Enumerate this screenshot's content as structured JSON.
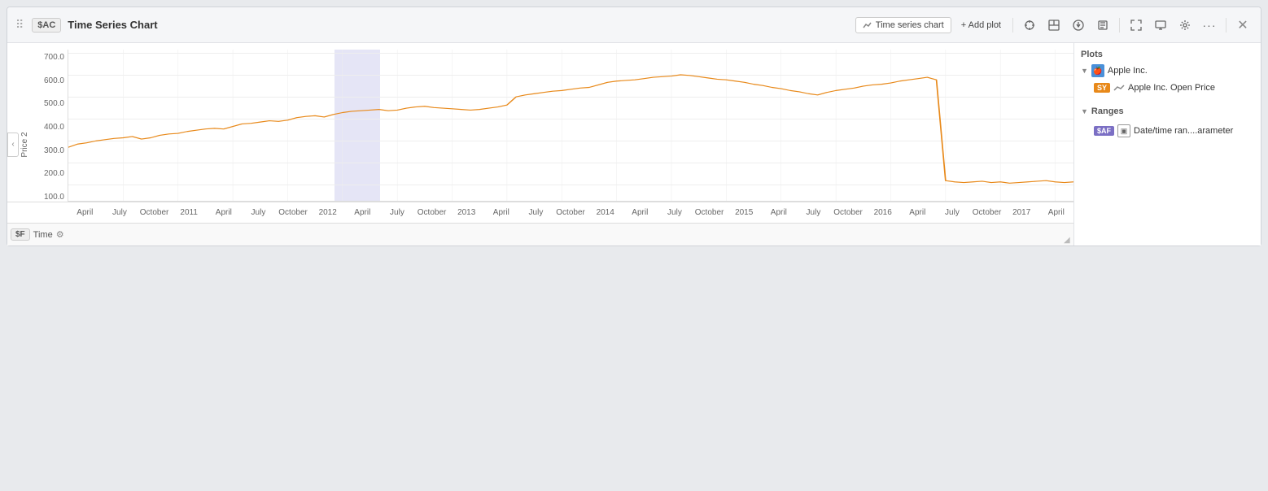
{
  "header": {
    "drag_handle": "⠿",
    "badge": "$AC",
    "title": "Time Series Chart",
    "time_series_btn": "Time series chart",
    "add_plot_btn": "+ Add plot",
    "close_btn": "✕"
  },
  "toolbar_icons": {
    "crosshair": "⊕",
    "layout": "▣",
    "download": "↓",
    "edit": "✎",
    "fullscreen": "⛶",
    "monitor": "🖥",
    "settings": "⚙",
    "more": "•••"
  },
  "chart": {
    "y_axis_label": "Price 2",
    "y_ticks": [
      "700.0",
      "600.0",
      "500.0",
      "400.0",
      "300.0",
      "200.0",
      "100.0"
    ],
    "x_ticks": [
      "April",
      "July",
      "October",
      "2011",
      "April",
      "July",
      "October",
      "2012",
      "April",
      "July",
      "October",
      "2013",
      "April",
      "July",
      "October",
      "2014",
      "April",
      "July",
      "October",
      "2015",
      "April",
      "July",
      "October",
      "2016",
      "April",
      "July",
      "October",
      "2017",
      "April"
    ],
    "x_badge": "$F",
    "x_label": "Time"
  },
  "right_panel": {
    "plots_label": "Plots",
    "apple_label": "Apple Inc.",
    "open_price_badge": "SY",
    "open_price_label": "Apple Inc. Open Price",
    "ranges_label": "Ranges",
    "range_badge": "$AF",
    "range_label": "Date/time ran....arameter"
  }
}
